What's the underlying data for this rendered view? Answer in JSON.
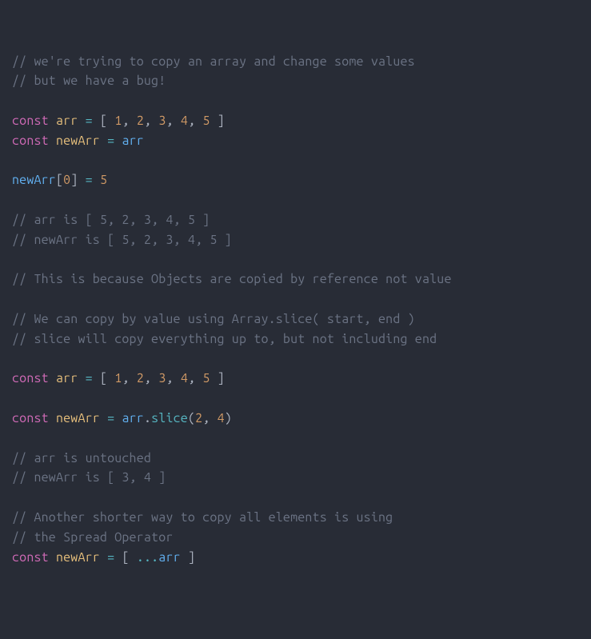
{
  "code": {
    "c_copy": "// we're trying to copy an array and change some values",
    "c_bug": "// but we have a bug!",
    "kw_const": "const",
    "id_arr": "arr",
    "id_newArr": "newArr",
    "op_assign": "=",
    "br_l": "[",
    "br_r": "]",
    "paren_l": "(",
    "paren_r": ")",
    "dot": ".",
    "comma": ",",
    "ellipsis": "...",
    "n0": "0",
    "n1": "1",
    "n2": "2",
    "n3": "3",
    "n4": "4",
    "n5": "5",
    "c_arr_is": "// arr is [ 5, 2, 3, 4, 5 ]",
    "c_newarr_is": "// newArr is [ 5, 2, 3, 4, 5 ]",
    "c_because": "// This is because Objects are copied by reference not value",
    "c_slice1": "// We can copy by value using Array.slice( start, end )",
    "c_slice2": "// slice will copy everything up to, but not including end",
    "fn_slice": "slice",
    "c_untouched": "// arr is untouched",
    "c_newarr34": "// newArr is [ 3, 4 ]",
    "c_another": "// Another shorter way to copy all elements is using",
    "c_spread": "// the Spread Operator"
  }
}
